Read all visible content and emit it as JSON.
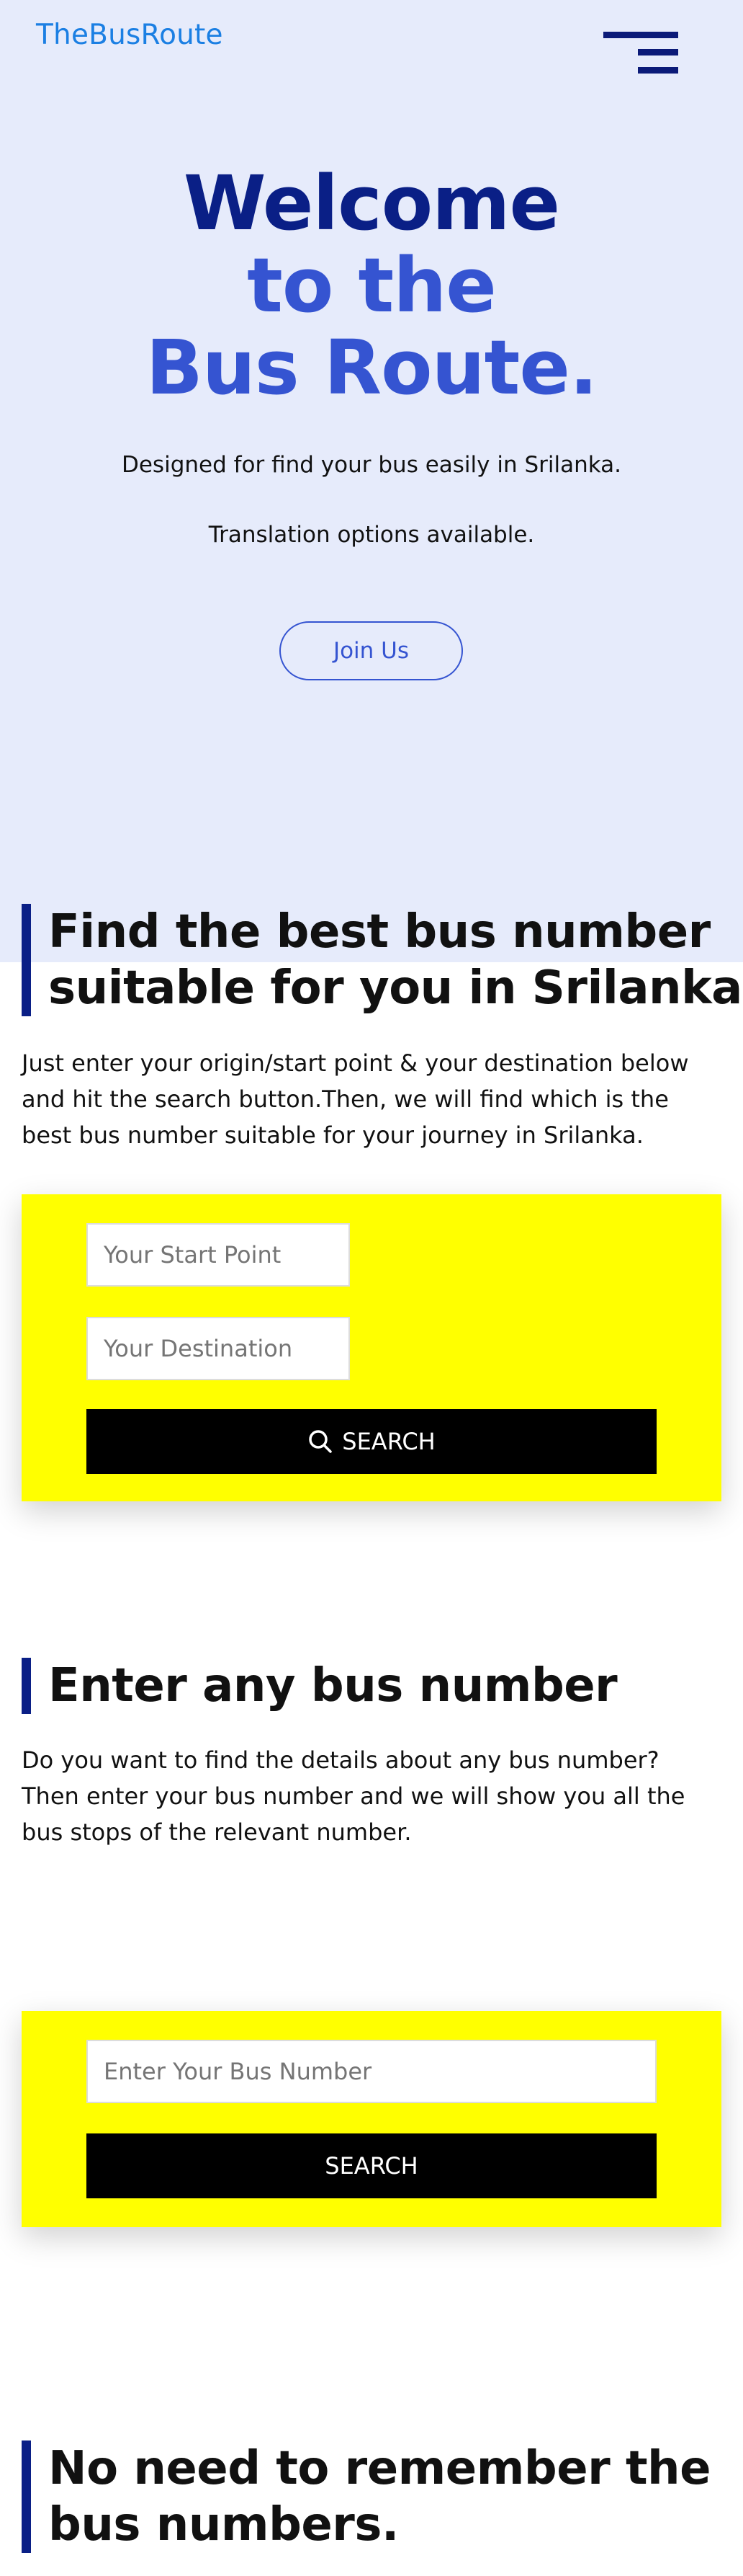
{
  "header": {
    "brand": "TheBusRoute",
    "menu_icon": "hamburger-menu-icon"
  },
  "hero": {
    "title_line1": "Welcome",
    "title_line2": "to the",
    "title_line3": "Bus Route.",
    "subtitle": "Designed for find your bus easily in Srilanka.",
    "note": "Translation options available.",
    "join_label": "Join Us",
    "colors": {
      "background": "#e6ebfb",
      "title_dark": "#0a1f86",
      "title_accent": "#3554d1"
    }
  },
  "route_search": {
    "title_line1": "Find the best bus number",
    "title_line2": "suitable for you in Srilanka",
    "description": "Just enter your origin/start point & your destination below and hit the search button.Then, we will find which is the best bus number suitable for your journey in Srilanka.",
    "start_placeholder": "Your Start Point",
    "destination_placeholder": "Your Destination",
    "search_label": "SEARCH",
    "search_icon": "search-icon",
    "panel_color": "#ffff00"
  },
  "number_search": {
    "title": "Enter any bus number",
    "description": "Do you want to find the details about any bus number? Then enter your bus number and we will show you all the bus stops of the relevant number.",
    "number_placeholder": "Enter Your Bus Number",
    "search_label": "SEARCH"
  },
  "memory": {
    "title_line1": "No need to remember the",
    "title_line2": "bus numbers."
  }
}
